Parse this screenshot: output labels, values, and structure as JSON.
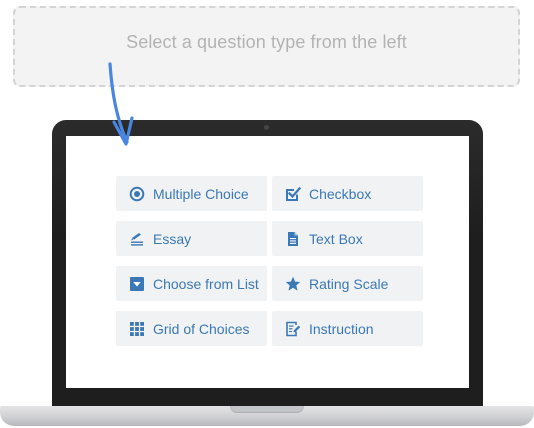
{
  "dropzone": {
    "hint": "Select a question type from the left"
  },
  "question_types": [
    {
      "label": "Multiple Choice",
      "icon": "radio-icon"
    },
    {
      "label": "Checkbox",
      "icon": "checkbox-icon"
    },
    {
      "label": "Essay",
      "icon": "pencil-lines-icon"
    },
    {
      "label": "Text Box",
      "icon": "document-icon"
    },
    {
      "label": "Choose from List",
      "icon": "dropdown-icon"
    },
    {
      "label": "Rating Scale",
      "icon": "star-icon"
    },
    {
      "label": "Grid of Choices",
      "icon": "grid-icon"
    },
    {
      "label": "Instruction",
      "icon": "instruction-icon"
    }
  ],
  "colors": {
    "accent": "#3a79b5",
    "button_bg": "#f1f2f4",
    "arrow": "#4a86e0",
    "dropzone_text": "#b3b3b3"
  }
}
